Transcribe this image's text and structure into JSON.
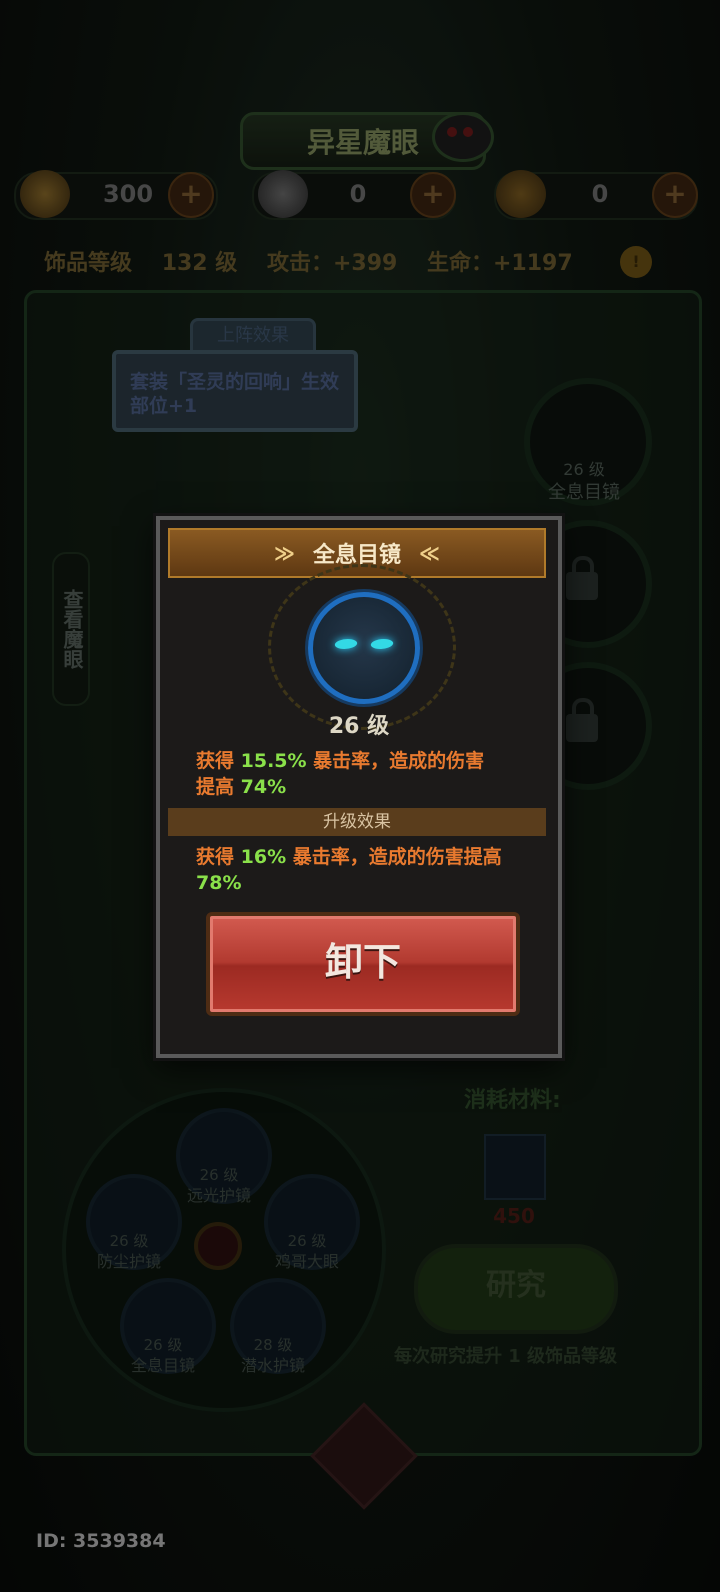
{
  "header": {
    "title": "异星魔眼"
  },
  "resources": [
    {
      "icon": "gold-gem-icon",
      "value": "300"
    },
    {
      "icon": "silver-gem-icon",
      "value": "0"
    },
    {
      "icon": "gold-medal-icon",
      "value": "0"
    }
  ],
  "stats": {
    "level_label": "饰品等级",
    "level_value": "132 级",
    "attack": "攻击：+399",
    "life": "生命：+1197"
  },
  "formation_effect": {
    "tab_label": "上阵效果",
    "text": "套装「圣灵的回响」生效部位+1"
  },
  "side_slots": [
    {
      "level": "26 级",
      "name": "全息目镜",
      "locked": false
    },
    {
      "locked": true
    },
    {
      "locked": true
    }
  ],
  "view_tab": "查看魔眼",
  "materials": {
    "label": "消耗材料:",
    "count": "450"
  },
  "research": {
    "button": "研究",
    "note": "每次研究提升 1 级饰品等级"
  },
  "wheel": [
    {
      "level": "26 级",
      "name": "远光护镜"
    },
    {
      "level": "26 级",
      "name": "防尘护镜"
    },
    {
      "level": "26 级",
      "name": "鸡哥大眼"
    },
    {
      "level": "26 级",
      "name": "全息目镜"
    },
    {
      "level": "28 级",
      "name": "潜水护镜"
    }
  ],
  "footer": {
    "id": "ID: 3539384"
  },
  "popup": {
    "title": "全息目镜",
    "level": "26 级",
    "current": {
      "p1": "获得 ",
      "v1": "15.5%",
      "p2": " 暴击率，造成的伤害提高 ",
      "v2": "74%"
    },
    "upgrade_label": "升级效果",
    "next": {
      "p1": "获得 ",
      "v1": "16%",
      "p2": " 暴击率，造成的伤害提高",
      "v2": "78%"
    },
    "button": "卸下"
  },
  "colors": {
    "accent_orange": "#e87a2f",
    "value_green": "#8ae04a",
    "button_red": "#b23a30"
  }
}
